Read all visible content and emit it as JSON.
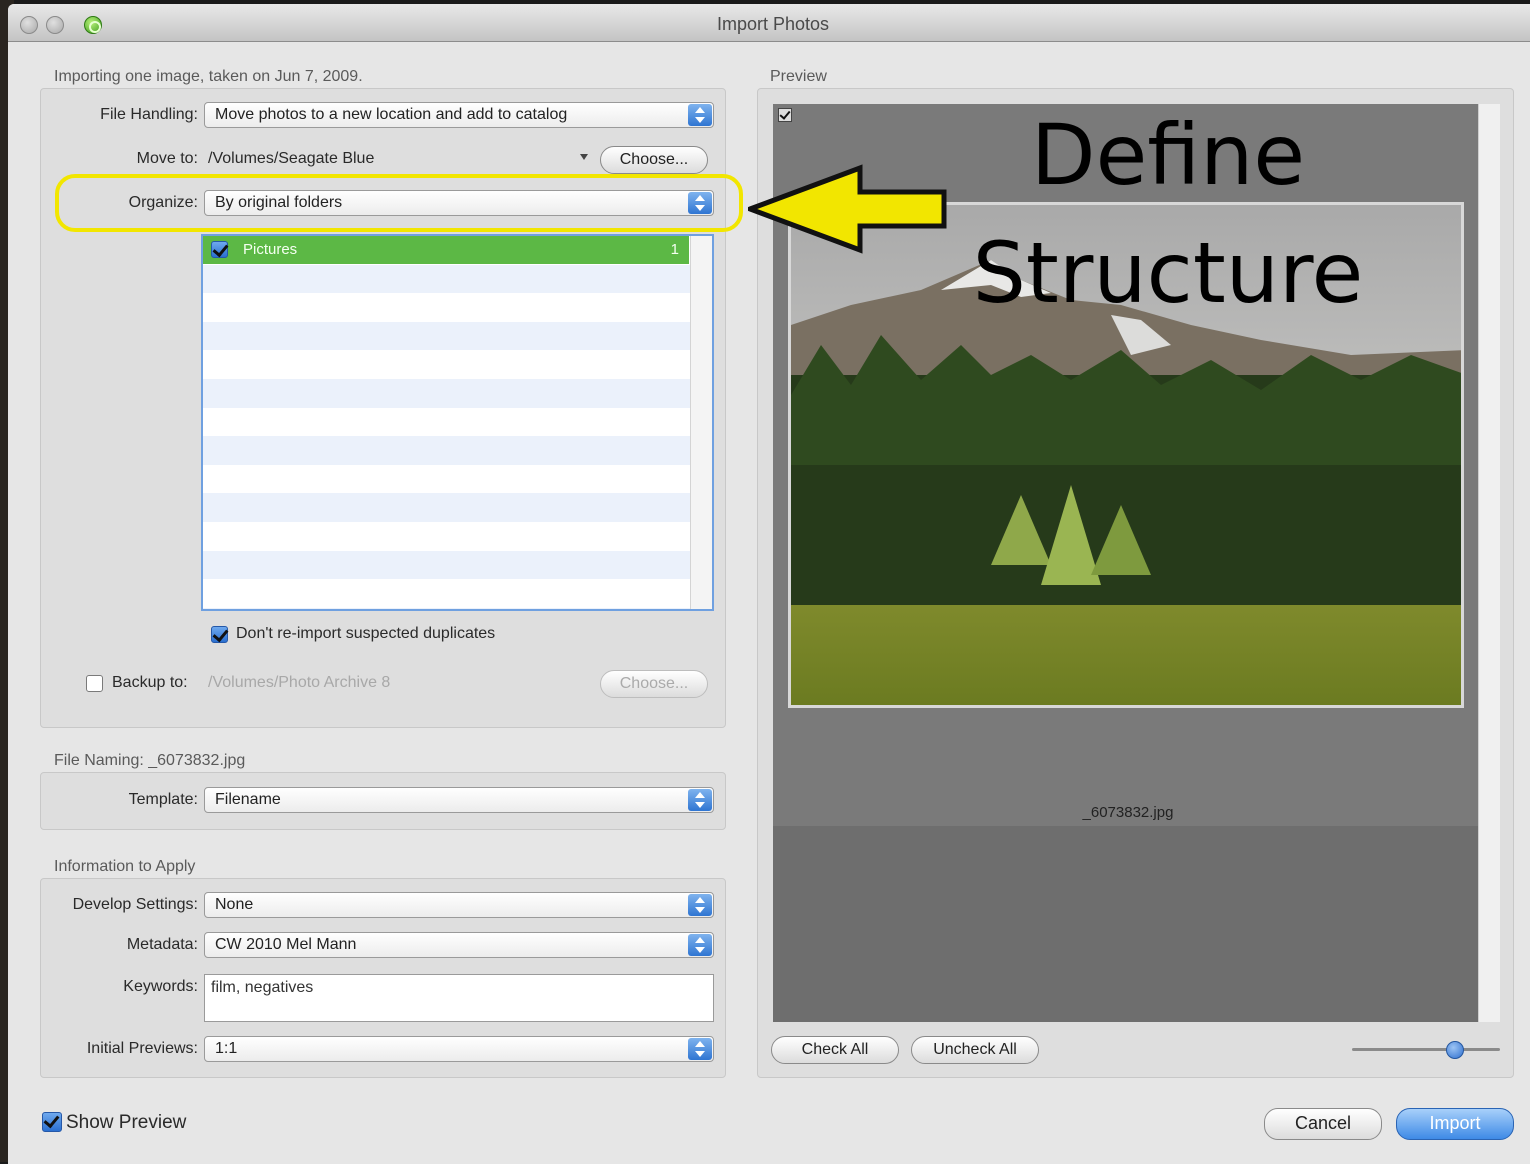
{
  "window": {
    "title": "Import Photos"
  },
  "import_summary": "Importing one image, taken on Jun 7, 2009.",
  "file_handling": {
    "label": "File Handling:",
    "value": "Move photos to a new location and add to catalog",
    "move_to_label": "Move to:",
    "move_to_path": "/Volumes/Seagate Blue",
    "choose_label": "Choose...",
    "organize_label": "Organize:",
    "organize_value": "By original folders",
    "folders": [
      {
        "name": "Pictures",
        "count": "1",
        "checked": true
      }
    ],
    "no_duplicates_label": "Don't re-import suspected duplicates",
    "backup_label": "Backup to:",
    "backup_path": "/Volumes/Photo Archive 8",
    "backup_choose_label": "Choose..."
  },
  "file_naming": {
    "header": "File Naming:  _6073832.jpg",
    "template_label": "Template:",
    "template_value": "Filename"
  },
  "info_apply": {
    "header": "Information to Apply",
    "develop_label": "Develop Settings:",
    "develop_value": "None",
    "metadata_label": "Metadata:",
    "metadata_value": "CW 2010 Mel Mann",
    "keywords_label": "Keywords:",
    "keywords_value": "film, negatives",
    "previews_label": "Initial Previews:",
    "previews_value": "1:1"
  },
  "preview": {
    "header": "Preview",
    "filename": "_6073832.jpg",
    "check_all": "Check All",
    "uncheck_all": "Uncheck All",
    "zoom_level": 0.72
  },
  "footer": {
    "show_preview_label": "Show Preview",
    "cancel_label": "Cancel",
    "import_label": "Import"
  },
  "annotation": {
    "line1": "Define",
    "line2": "Structure",
    "color": "#f2e600"
  }
}
